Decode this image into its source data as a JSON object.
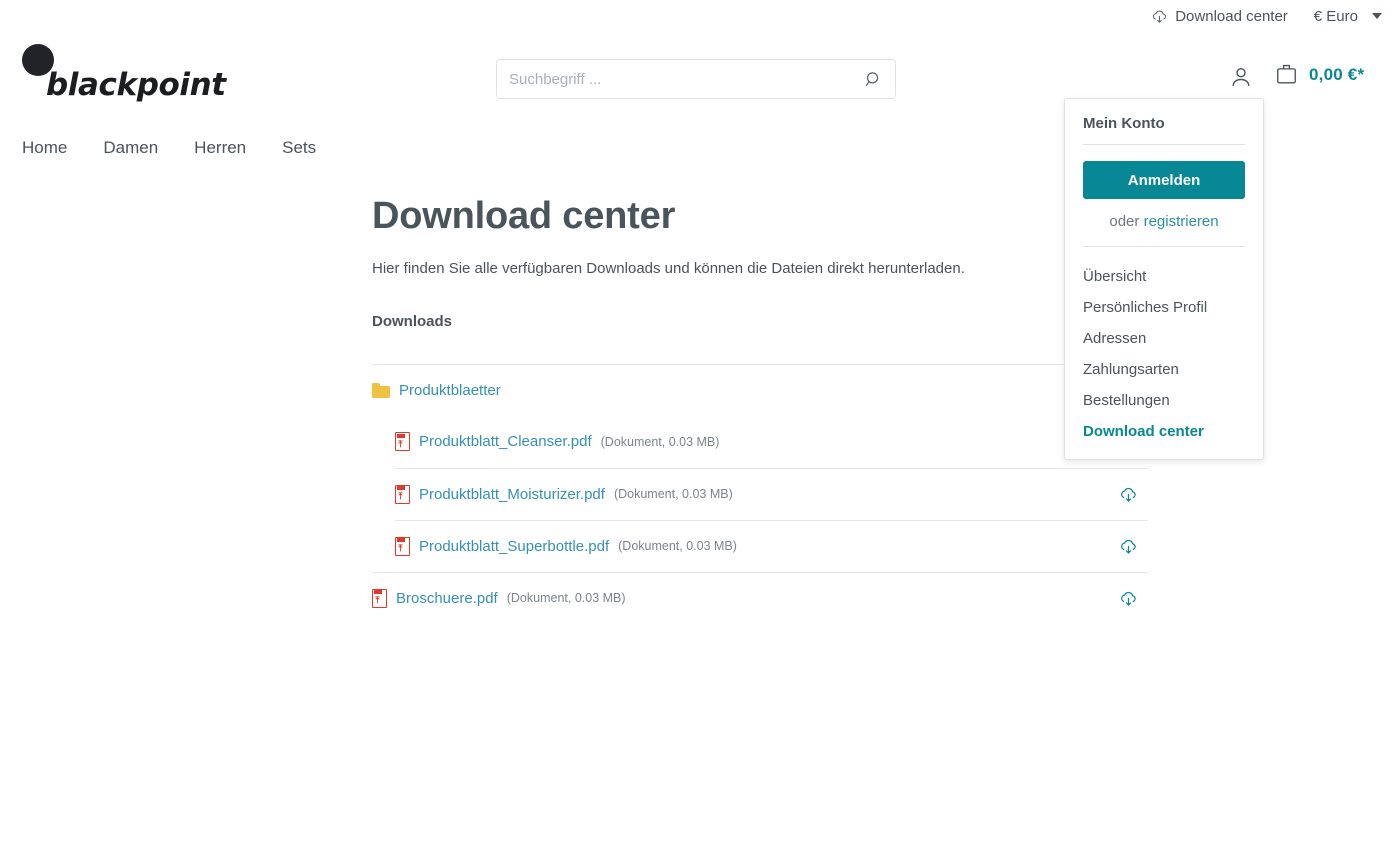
{
  "topbar": {
    "download_center": {
      "label": "Download center",
      "icon": "cloud-download-icon"
    },
    "currency": {
      "label": "€ Euro",
      "icon": "chevron-down-icon"
    }
  },
  "header": {
    "logo_text": "blackpoint",
    "search": {
      "value": "",
      "placeholder": "Suchbegriff ...",
      "icon": "search-icon"
    },
    "account_icon": "user-icon",
    "cart": {
      "icon": "bag-icon",
      "total": "0,00 €*"
    }
  },
  "nav": {
    "items": [
      {
        "label": "Home"
      },
      {
        "label": "Damen"
      },
      {
        "label": "Herren"
      },
      {
        "label": "Sets"
      }
    ]
  },
  "main": {
    "title": "Download center",
    "subtitle": "Hier finden Sie alle verfügbaren Downloads und können die Dateien direkt herunterladen.",
    "section_title": "Downloads",
    "rows": [
      {
        "name": "Produktblaetter",
        "meta": "",
        "type": "folder",
        "level": 1,
        "rule": true,
        "action": ""
      },
      {
        "name": "Produktblatt_Cleanser.pdf",
        "meta": "(Dokument, 0.03 MB)",
        "type": "pdf",
        "level": 2,
        "rule": false,
        "action": "cloud-download-icon"
      },
      {
        "name": "Produktblatt_Moisturizer.pdf",
        "meta": "(Dokument, 0.03 MB)",
        "type": "pdf",
        "level": 2,
        "rule": true,
        "action": "cloud-download-icon"
      },
      {
        "name": "Produktblatt_Superbottle.pdf",
        "meta": "(Dokument, 0.03 MB)",
        "type": "pdf",
        "level": 2,
        "rule": true,
        "action": "cloud-download-icon"
      },
      {
        "name": "Broschuere.pdf",
        "meta": "(Dokument, 0.03 MB)",
        "type": "pdf",
        "level": 1,
        "rule": true,
        "action": "cloud-download-icon"
      }
    ]
  },
  "account_dropdown": {
    "title": "Mein Konto",
    "login_label": "Anmelden",
    "or_text": "oder ",
    "register_label": "registrieren",
    "links": [
      {
        "label": "Übersicht",
        "active": false
      },
      {
        "label": "Persönliches Profil",
        "active": false
      },
      {
        "label": "Adressen",
        "active": false
      },
      {
        "label": "Zahlungsarten",
        "active": false
      },
      {
        "label": "Bestellungen",
        "active": false
      },
      {
        "label": "Download center",
        "active": true
      }
    ]
  },
  "colors": {
    "accent_teal": "#088794",
    "link_blue": "#3491b5",
    "text_gray": "#4a545b",
    "pdf_red": "#e0392b",
    "folder_yellow": "#eec344"
  }
}
